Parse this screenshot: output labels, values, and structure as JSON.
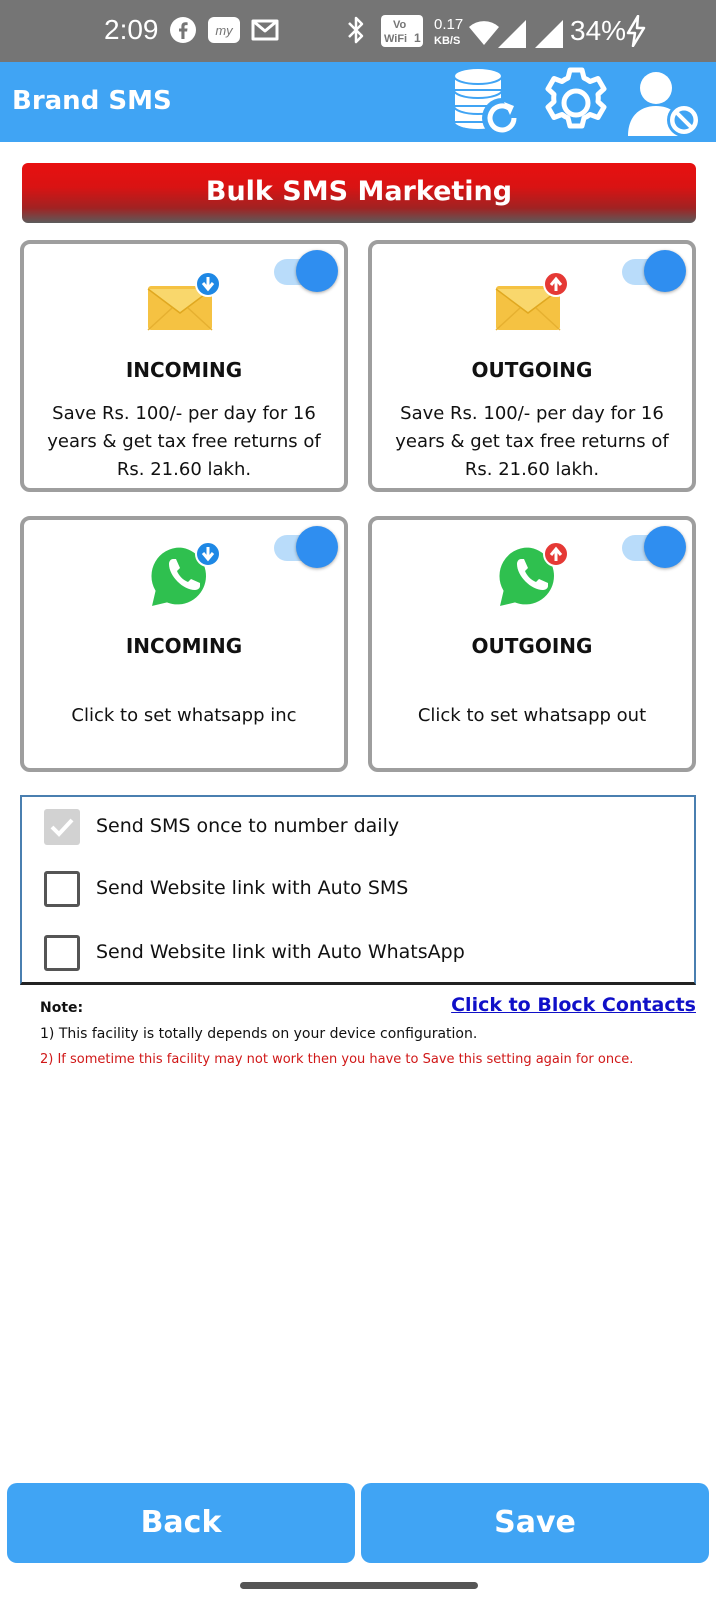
{
  "status_bar": {
    "time": "2:09",
    "network_speed_value": "0.17",
    "network_speed_unit": "KB/S",
    "volte_label": "Vo",
    "wifi_label": "WiFi",
    "sim_slot": "1",
    "battery": "34%",
    "icons": [
      "facebook-icon",
      "mygov-icon",
      "gmail-icon",
      "bluetooth-icon",
      "volte-wifi-icon",
      "wifi-icon",
      "signal-icon",
      "signal-icon",
      "charging-icon"
    ]
  },
  "app_bar": {
    "title": "Brand SMS",
    "actions": [
      "database-restore-icon",
      "settings-gear-icon",
      "user-block-icon"
    ]
  },
  "banner": {
    "title": "Bulk SMS Marketing"
  },
  "cards": [
    {
      "title": "INCOMING",
      "description": "Save Rs. 100/- per day for 16 years & get tax free returns of Rs. 21.60 lakh.",
      "icon": "email-incoming-icon",
      "enabled": true
    },
    {
      "title": "OUTGOING",
      "description": "Save Rs. 100/- per day for 16 years & get tax free returns of Rs. 21.60 lakh.",
      "icon": "email-outgoing-icon",
      "enabled": true
    },
    {
      "title": "INCOMING",
      "description": "Click to set whatsapp inc",
      "icon": "whatsapp-incoming-icon",
      "enabled": true
    },
    {
      "title": "OUTGOING",
      "description": "Click to set whatsapp out",
      "icon": "whatsapp-outgoing-icon",
      "enabled": true
    }
  ],
  "options": [
    {
      "label": "Send SMS once to number daily",
      "checked": true
    },
    {
      "label": "Send Website link with Auto SMS",
      "checked": false
    },
    {
      "label": "Send Website link with Auto WhatsApp",
      "checked": false
    }
  ],
  "note": {
    "label": "Note:",
    "link": "Click to Block Contacts",
    "line1": "1) This facility is totally depends on your device configuration.",
    "line2": "2) If sometime this facility may not work then you have to Save this setting again for once."
  },
  "buttons": {
    "back": "Back",
    "save": "Save"
  },
  "colors": {
    "primary": "#40a4f4",
    "toggle_on": "#2f8ef0",
    "banner_red": "#e81010",
    "warning_text": "#d01818",
    "link": "#1010c8",
    "status_bar": "#757575"
  }
}
